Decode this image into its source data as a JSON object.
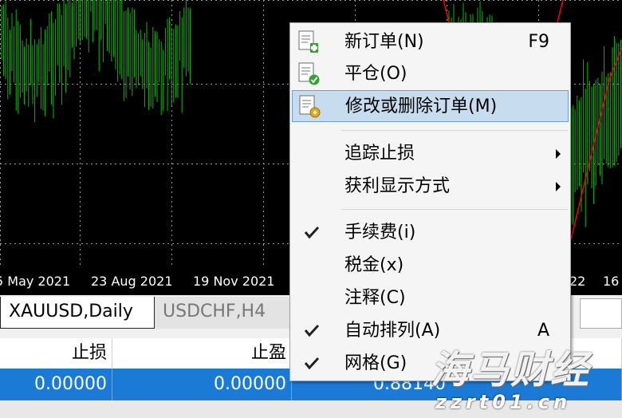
{
  "chart": {
    "background": "#000000",
    "candle_color": "#00c000",
    "ma_color": "#ff0000",
    "dates": [
      "5 May 2021",
      "23 Aug 2021",
      "19 Nov 2021",
      "22",
      "16"
    ]
  },
  "tabs": [
    {
      "label": "XAUUSD,Daily",
      "active": true
    },
    {
      "label": "USDCHF,H4",
      "active": false
    }
  ],
  "table": {
    "headers": [
      "止损",
      "止盈",
      ""
    ],
    "row": [
      "0.00000",
      "0.00000",
      "0.88140"
    ],
    "selected_color": "#1a7ad6"
  },
  "menu": {
    "items": [
      {
        "label": "新订单(N)",
        "shortcut": "F9",
        "icon": "new-order-icon"
      },
      {
        "label": "平仓(O)",
        "shortcut": "",
        "icon": "close-position-icon"
      },
      {
        "label": "修改或删除订单(M)",
        "shortcut": "",
        "icon": "modify-order-icon",
        "highlighted": true
      },
      {
        "label": "追踪止损",
        "submenu": true
      },
      {
        "label": "获利显示方式",
        "submenu": true
      },
      {
        "label": "手续费(i)",
        "checked": true
      },
      {
        "label": "税金(x)",
        "checked": false
      },
      {
        "label": "注释(C)",
        "checked": false
      },
      {
        "label": "自动排列(A)",
        "shortcut": "A",
        "checked": true
      },
      {
        "label": "网格(G)",
        "checked": true
      }
    ],
    "highlight_color": "#c8dcef"
  },
  "watermark": {
    "line1": "海马财经",
    "line2": "zzrt01.cn"
  }
}
